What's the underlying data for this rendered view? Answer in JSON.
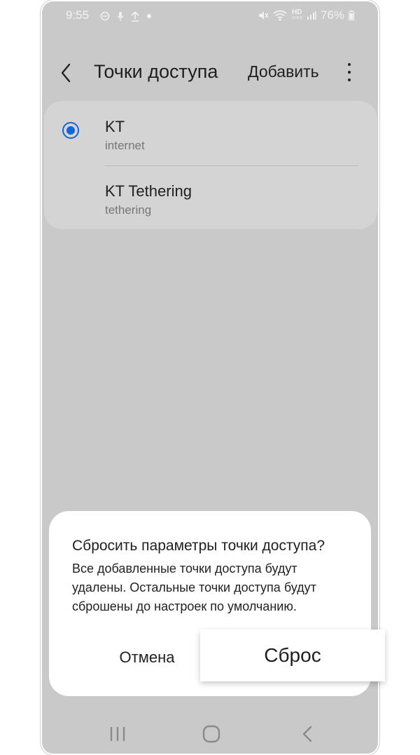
{
  "status_bar": {
    "time": "9:55",
    "left_icons": [
      "minus-circle-icon",
      "mic-icon",
      "upload-icon",
      "dot-icon"
    ],
    "right_icons": [
      "mute-icon",
      "wifi-icon",
      "hd-voice-icon",
      "signal-icon"
    ],
    "hd_label": "HD",
    "voice_label": "VOICE",
    "battery_percent": "76%"
  },
  "app_bar": {
    "title": "Точки доступа",
    "add_label": "Добавить"
  },
  "apn_list": [
    {
      "name": "KT",
      "apn": "internet",
      "selected": true
    },
    {
      "name": "KT Tethering",
      "apn": "tethering",
      "selected": false
    }
  ],
  "dialog": {
    "title": "Сбросить параметры точки доступа?",
    "body_lines": [
      "Все добавленные точки доступа будут",
      "удалены. Остальные точки доступа будут",
      "сброшены до настроек по умолчанию."
    ],
    "cancel_label": "Отмена",
    "reset_label": "Сброс"
  },
  "nav_bar": {
    "icons": [
      "recent-apps-icon",
      "home-icon",
      "back-icon"
    ]
  },
  "colors": {
    "accent": "#1565d8",
    "dim_background": "#c9c9c9",
    "card": "#d4d4d4",
    "dialog": "#ffffff"
  }
}
